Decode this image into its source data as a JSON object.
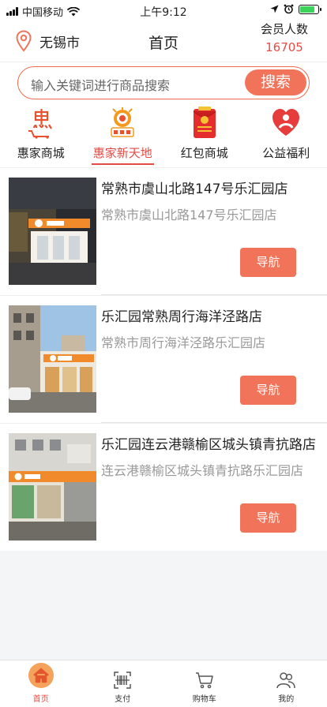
{
  "status_bar": {
    "carrier": "中国移动",
    "time": "上午9:12",
    "battery_level": 0.85
  },
  "header": {
    "city": "无锡市",
    "title": "首页",
    "members_label": "会员人数",
    "members_count": "16705"
  },
  "search": {
    "placeholder": "输入关键词进行商品搜索",
    "button": "搜索"
  },
  "categories": [
    {
      "label": "惠家商城",
      "icon": "hui-logo-icon"
    },
    {
      "label": "惠家新天地",
      "icon": "lehuiyuan-logo-icon",
      "active": true
    },
    {
      "label": "红包商城",
      "icon": "red-envelope-icon"
    },
    {
      "label": "公益福利",
      "icon": "heart-person-icon"
    }
  ],
  "stores": [
    {
      "name": "常熟市虞山北路147号乐汇园店",
      "address": "常熟市虞山北路147号乐汇园店",
      "nav": "导航"
    },
    {
      "name": "乐汇园常熟周行海洋泾路店",
      "address": "常熟市周行海洋泾路乐汇园店",
      "nav": "导航"
    },
    {
      "name": "乐汇园连云港赣榆区城头镇青抗路店",
      "address": "连云港赣榆区城头镇青抗路乐汇园店",
      "nav": "导航"
    }
  ],
  "tabbar": [
    {
      "label": "首页",
      "icon": "home-icon",
      "active": true
    },
    {
      "label": "支付",
      "icon": "barcode-icon"
    },
    {
      "label": "购物车",
      "icon": "cart-icon"
    },
    {
      "label": "我的",
      "icon": "user-icon"
    }
  ],
  "colors": {
    "accent": "#f0735a",
    "active_text": "#e34b45"
  }
}
